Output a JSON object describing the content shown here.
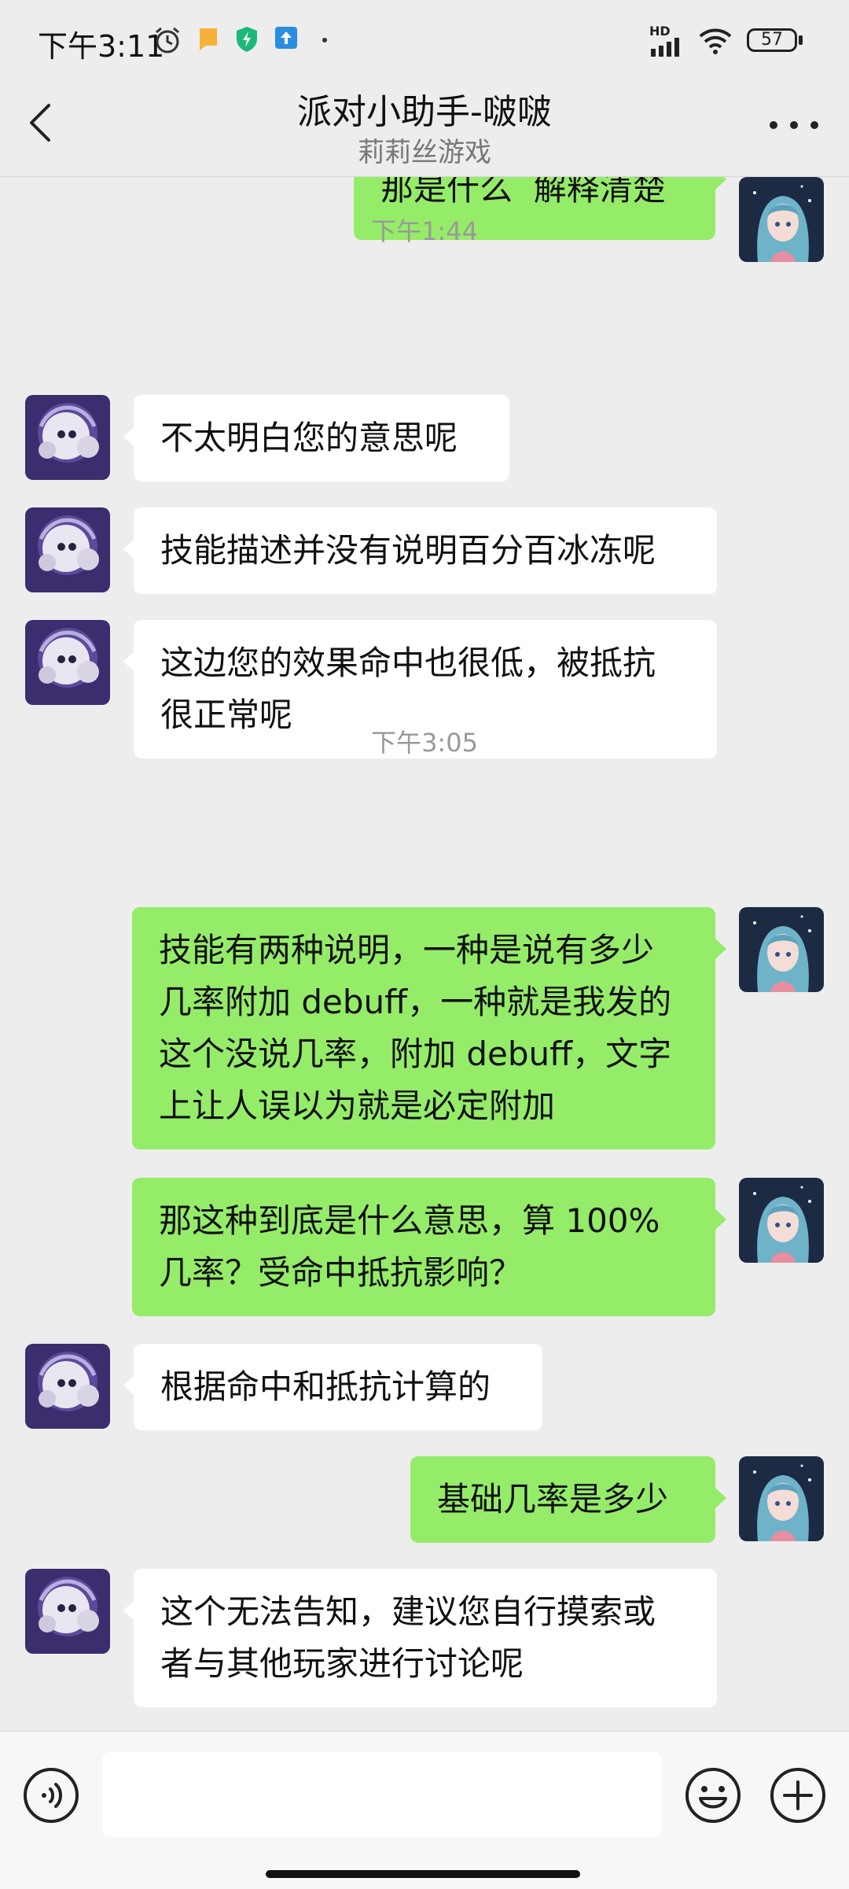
{
  "status_bar": {
    "time": "下午3:11",
    "network": "HD",
    "battery": "57"
  },
  "header": {
    "title": "派对小助手-啵啵",
    "subtitle": "莉莉丝游戏"
  },
  "messages": [
    {
      "side": "right",
      "text": "那是什么  解释清楚"
    },
    {
      "type": "time",
      "text": "下午1:44"
    },
    {
      "side": "left",
      "text": "不太明白您的意思呢"
    },
    {
      "side": "left",
      "text": "技能描述并没有说明百分百冰冻呢"
    },
    {
      "side": "left",
      "lines": [
        "这边您的效果命中也很低，被抵抗",
        "很正常呢"
      ]
    },
    {
      "type": "time",
      "text": "下午3:05"
    },
    {
      "side": "right",
      "lines": [
        "技能有两种说明，一种是说有多少",
        "几率附加 debuff，一种就是我发的",
        "这个没说几率，附加 debuff，文字",
        "上让人误以为就是必定附加"
      ]
    },
    {
      "side": "right",
      "lines": [
        "那这种到底是什么意思，算 100%",
        "几率？受命中抵抗影响？"
      ]
    },
    {
      "side": "left",
      "text": "根据命中和抵抗计算的"
    },
    {
      "side": "right",
      "text": "基础几率是多少"
    },
    {
      "side": "left",
      "lines": [
        "这个无法告知，建议您自行摸索或",
        "者与其他玩家进行讨论呢"
      ]
    }
  ],
  "input": {
    "value": "",
    "placeholder": ""
  },
  "colors": {
    "background": "#ededed",
    "bubble_right": "#95ec69",
    "bubble_left": "#ffffff",
    "timestamp": "#999999"
  },
  "icons": [
    "alarm-icon",
    "notification-icon",
    "shield-icon",
    "upload-icon",
    "signal-icon",
    "wifi-icon",
    "battery-icon",
    "back-icon",
    "more-icon",
    "voice-icon",
    "emoji-icon",
    "plus-icon"
  ]
}
